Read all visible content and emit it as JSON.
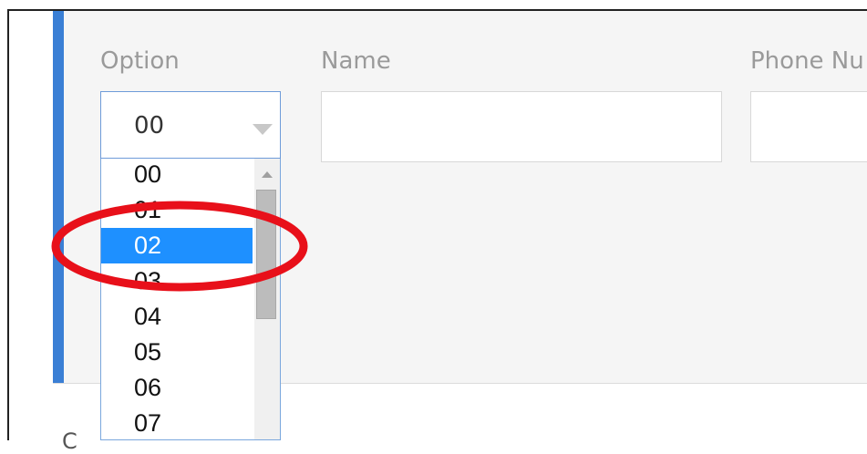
{
  "form": {
    "option_label": "Option",
    "name_label": "Name",
    "phone_label": "Phone Nu",
    "option_selected": "00"
  },
  "dropdown": {
    "options": [
      "00",
      "01",
      "02",
      "03",
      "04",
      "05",
      "06",
      "07"
    ],
    "highlighted_option": "02"
  },
  "below_panel_text": "C",
  "colors": {
    "accent": "#3a7fd5",
    "selected_option": "#1e90ff",
    "annotation": "#e8101a"
  }
}
